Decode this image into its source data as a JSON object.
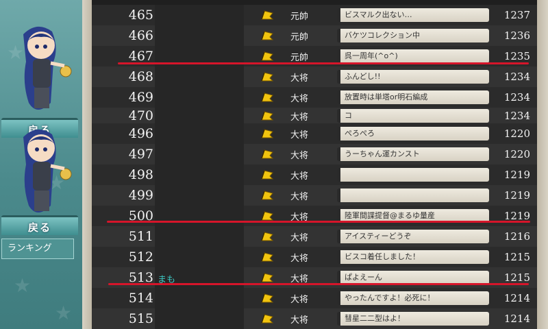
{
  "sidebar": {
    "back_label": "戻る",
    "ranking_label": "ランキング",
    "accent": "#4f9393"
  },
  "rows": [
    {
      "rank": "465",
      "name": "",
      "title": "元帥",
      "comment": "ビスマルク出ない…",
      "score": "1237"
    },
    {
      "rank": "466",
      "name": "",
      "title": "元帥",
      "comment": "バケツコレクション中",
      "score": "1236"
    },
    {
      "rank": "467",
      "name": "",
      "title": "元帥",
      "comment": "呉一周年(^o^)",
      "score": "1235"
    },
    {
      "rank": "468",
      "name": "",
      "title": "大将",
      "comment": "ふんどし!!",
      "score": "1234"
    },
    {
      "rank": "469",
      "name": "",
      "title": "大将",
      "comment": "放置時は単塔or明石編成",
      "score": "1234"
    },
    {
      "rank": "470",
      "name": "",
      "title": "大将",
      "comment": "コ",
      "score": "1234"
    },
    {
      "rank": "496",
      "name": "",
      "title": "大将",
      "comment": "ぺろぺろ",
      "score": "1220"
    },
    {
      "rank": "497",
      "name": "",
      "title": "大将",
      "comment": "うーちゃん運カンスト",
      "score": "1220"
    },
    {
      "rank": "498",
      "name": "",
      "title": "大将",
      "comment": "",
      "score": "1219"
    },
    {
      "rank": "499",
      "name": "",
      "title": "大将",
      "comment": "",
      "score": "1219"
    },
    {
      "rank": "500",
      "name": "",
      "title": "大将",
      "comment": "陸軍間諜提督@まるゆ量産",
      "score": "1219"
    },
    {
      "rank": "511",
      "name": "",
      "title": "大将",
      "comment": "アイスティーどうぞ",
      "score": "1216"
    },
    {
      "rank": "512",
      "name": "",
      "title": "大将",
      "comment": "ビスコ着任しました！",
      "score": "1215"
    },
    {
      "rank": "513",
      "name": "まも",
      "title": "大将",
      "comment": "ぱよえーん",
      "score": "1215"
    },
    {
      "rank": "514",
      "name": "",
      "title": "大将",
      "comment": "やったんですよ！必死に！",
      "score": "1214"
    },
    {
      "rank": "515",
      "name": "",
      "title": "大将",
      "comment": "彗星二二型はよ！",
      "score": "1214"
    }
  ],
  "colors": {
    "highlight_line": "#d6152a",
    "player_name": "#3cc7c2"
  }
}
